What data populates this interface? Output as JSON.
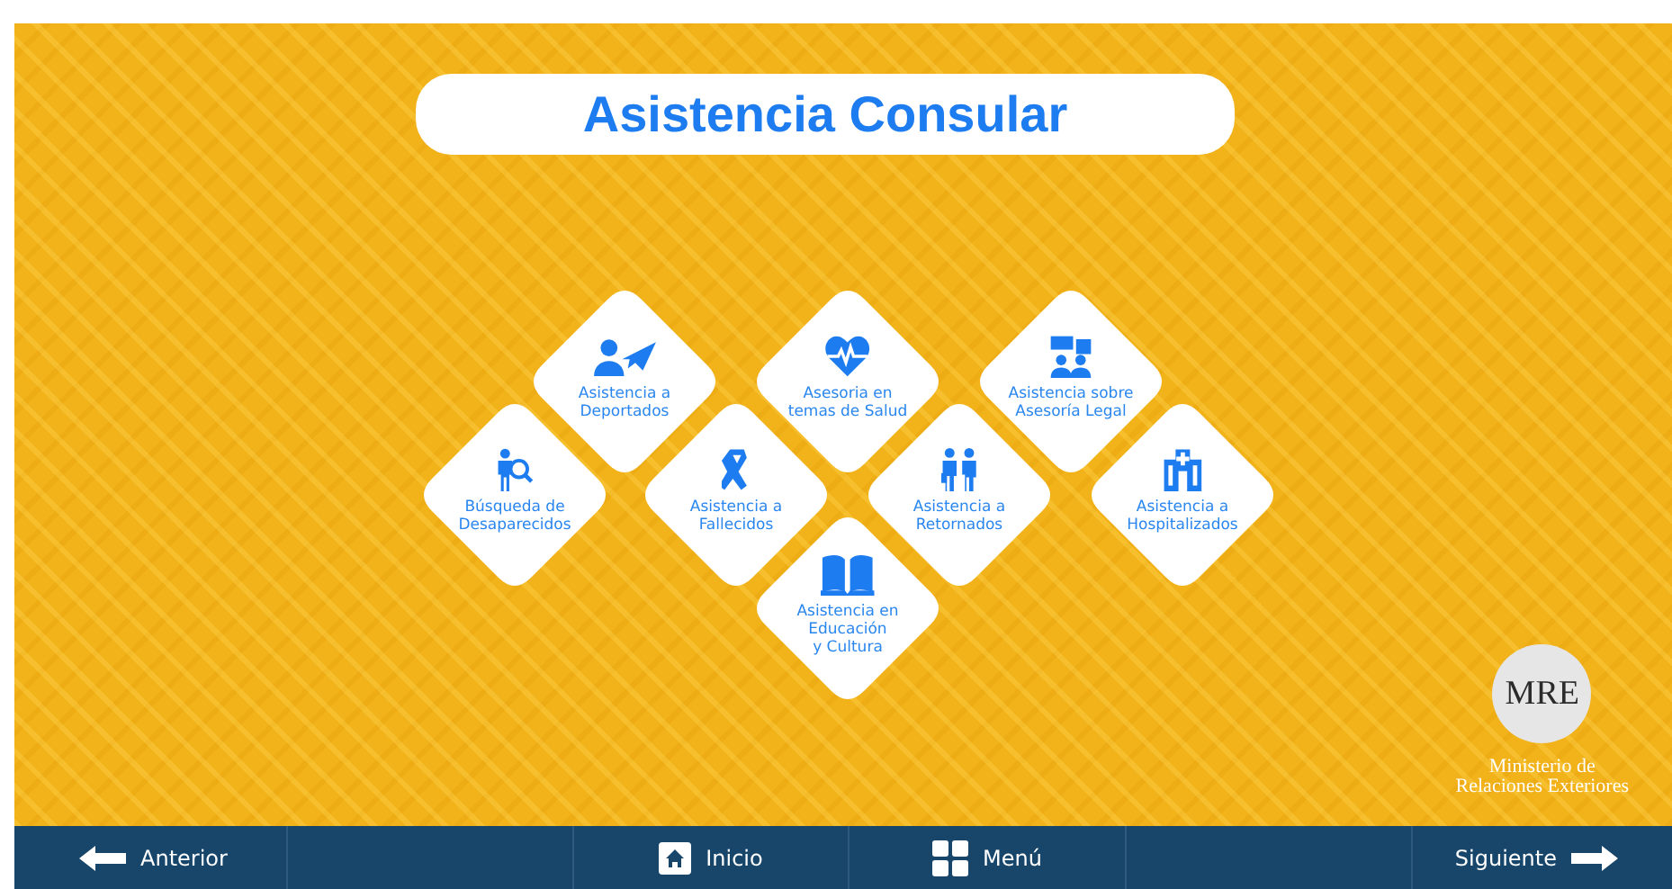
{
  "title": "Asistencia Consular",
  "services": [
    {
      "kind": "deported",
      "label": "Asistencia a\nDeportados"
    },
    {
      "kind": "health",
      "label": "Asesoria en\ntemas de Salud"
    },
    {
      "kind": "legal",
      "label": "Asistencia sobre\nAsesoría Legal"
    },
    {
      "kind": "search",
      "label": "Búsqueda de\nDesaparecidos"
    },
    {
      "kind": "deceased",
      "label": "Asistencia a\nFallecidos"
    },
    {
      "kind": "returned",
      "label": "Asistencia a\nRetornados"
    },
    {
      "kind": "hospital",
      "label": "Asistencia a\nHospitalizados"
    },
    {
      "kind": "education",
      "label": "Asistencia en\nEducación\ny Cultura"
    }
  ],
  "logo": {
    "mark": "MRE",
    "name": "Ministerio de\nRelaciones Exteriores"
  },
  "nav": [
    {
      "kind": "prev",
      "label": "Anterior"
    },
    {
      "kind": "home",
      "label": "Inicio"
    },
    {
      "kind": "menu",
      "label": "Menú"
    },
    {
      "kind": "next",
      "label": "Siguiente"
    }
  ]
}
